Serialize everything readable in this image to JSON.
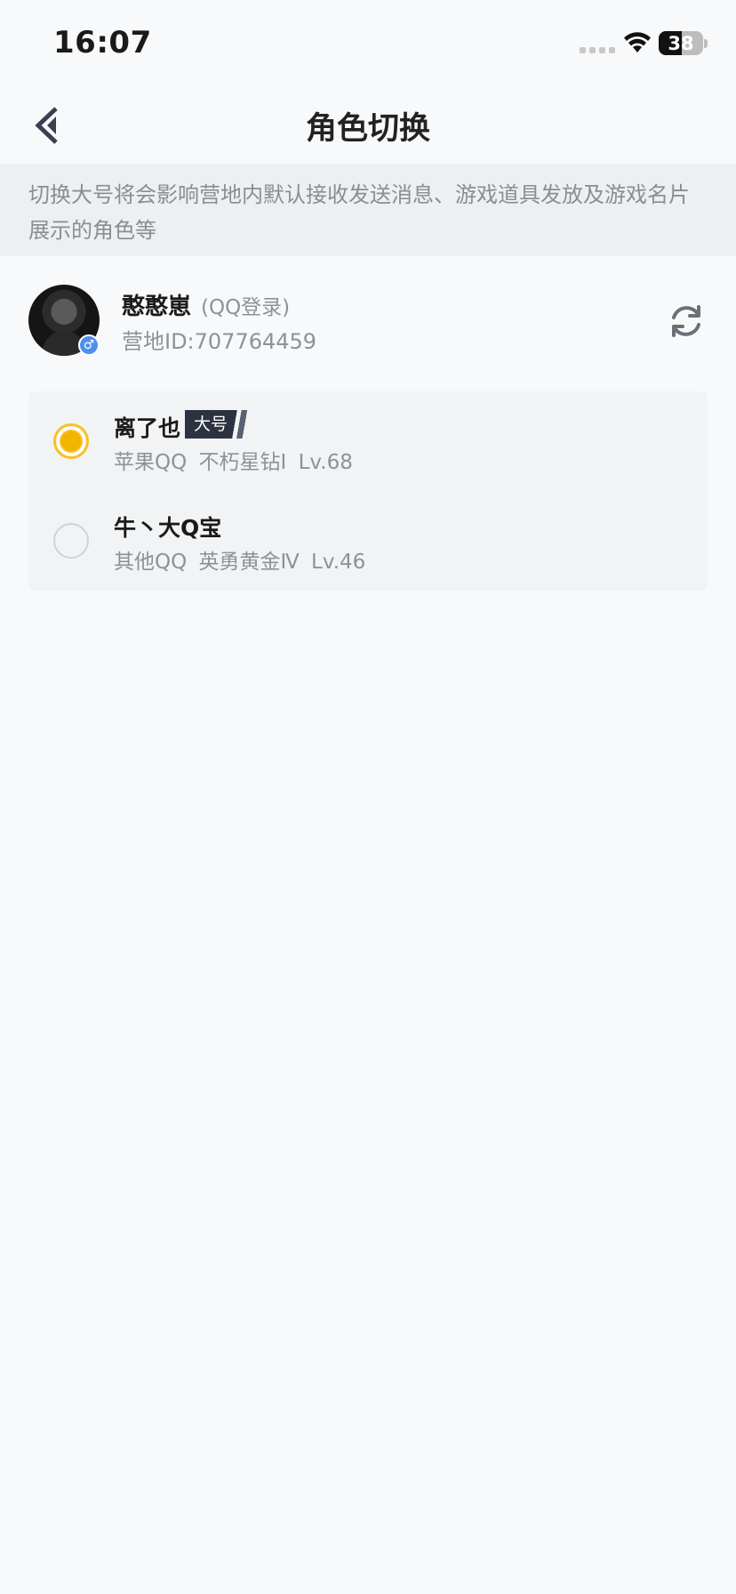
{
  "status_bar": {
    "time": "16:07",
    "battery": "38"
  },
  "nav": {
    "title": "角色切换"
  },
  "notice": {
    "text": "切换大号将会影响营地内默认接收发送消息、游戏道具发放及游戏名片展示的角色等"
  },
  "profile": {
    "nickname": "憨憨崽",
    "login_type": "(QQ登录)",
    "camp_id": "营地ID:707764459",
    "gender": "♂"
  },
  "roles": [
    {
      "name": "离了也",
      "badge": "大号",
      "meta": "苹果QQ  不朽星钻I  Lv.68",
      "selected": true
    },
    {
      "name": "牛丶大Q宝",
      "badge": "",
      "meta": "其他QQ  英勇黄金Ⅳ  Lv.46",
      "selected": false
    }
  ],
  "colors": {
    "accent": "#f7c026",
    "badge_bg": "#2d3240",
    "gender_badge": "#4c8ff2"
  }
}
